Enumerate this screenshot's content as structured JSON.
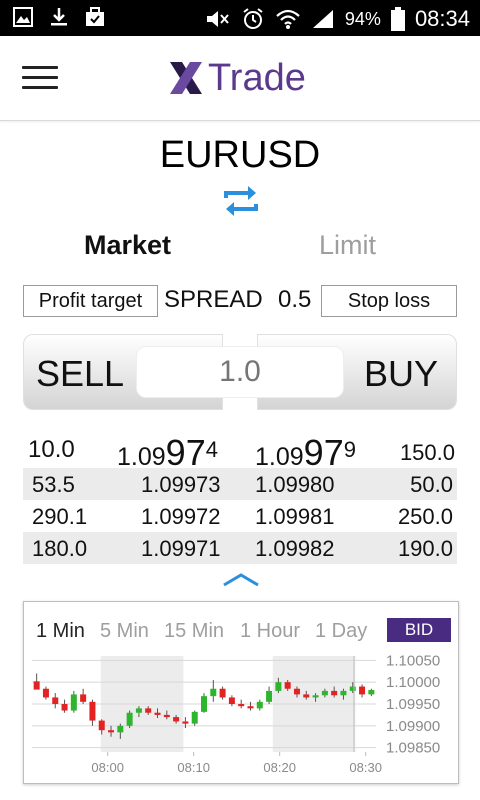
{
  "status_bar": {
    "battery_pct": "94%",
    "time": "08:34",
    "icons": [
      "gallery-icon",
      "download-icon",
      "briefcase-icon",
      "mute-icon",
      "alarm-icon",
      "wifi-icon",
      "signal-icon",
      "battery-icon"
    ]
  },
  "app": {
    "logo_text": "Trade",
    "menu_icon": "hamburger-icon"
  },
  "symbol": "EURUSD",
  "tabs": {
    "market": "Market",
    "limit": "Limit"
  },
  "controls": {
    "profit_target": "Profit target",
    "spread_label": "SPREAD",
    "spread_value": "0.5",
    "stop_loss": "Stop loss"
  },
  "trade": {
    "sell": "SELL",
    "buy": "BUY",
    "quantity_placeholder": "1.0"
  },
  "orderbook": {
    "top": {
      "bid_volume": "10.0",
      "bid_prefix": "1.09",
      "bid_big": "97",
      "bid_pip": "4",
      "ask_prefix": "1.09",
      "ask_big": "97",
      "ask_pip": "9",
      "ask_volume": "150.0"
    },
    "rows": [
      {
        "bid_volume": "53.5",
        "bid": "1.09973",
        "ask": "1.09980",
        "ask_volume": "50.0"
      },
      {
        "bid_volume": "290.1",
        "bid": "1.09972",
        "ask": "1.09981",
        "ask_volume": "250.0"
      },
      {
        "bid_volume": "180.0",
        "bid": "1.09971",
        "ask": "1.09982",
        "ask_volume": "190.0"
      }
    ]
  },
  "chart": {
    "timeframes": [
      "1 Min",
      "5 Min",
      "15 Min",
      "1 Hour",
      "1 Day"
    ],
    "active_timeframe": "1 Min",
    "price_mode": "BID",
    "y_ticks": [
      "1.10050",
      "1.10000",
      "1.09950",
      "1.09900",
      "1.09850"
    ],
    "x_ticks": [
      "08:00",
      "08:10",
      "08:20",
      "08:30"
    ],
    "colors": {
      "up": "#2db52d",
      "down": "#e52222",
      "shade": "#ececec",
      "accent": "#4a2b82"
    }
  },
  "chart_data": {
    "type": "candlestick",
    "y_range": [
      1.0984,
      1.1006
    ],
    "y_ticks": [
      1.1005,
      1.1,
      1.0995,
      1.099,
      1.0985
    ],
    "x_ticks": [
      "08:00",
      "08:10",
      "08:20",
      "08:30"
    ],
    "candles": [
      {
        "o": 1.10002,
        "h": 1.1002,
        "l": 1.09985,
        "c": 1.09983
      },
      {
        "o": 1.09985,
        "h": 1.0999,
        "l": 1.0996,
        "c": 1.09965
      },
      {
        "o": 1.09965,
        "h": 1.09975,
        "l": 1.0994,
        "c": 1.0995
      },
      {
        "o": 1.0995,
        "h": 1.0996,
        "l": 1.0993,
        "c": 1.09935
      },
      {
        "o": 1.09935,
        "h": 1.0998,
        "l": 1.0993,
        "c": 1.09972
      },
      {
        "o": 1.09972,
        "h": 1.09985,
        "l": 1.0995,
        "c": 1.09955
      },
      {
        "o": 1.09955,
        "h": 1.0996,
        "l": 1.099,
        "c": 1.09912
      },
      {
        "o": 1.09912,
        "h": 1.09915,
        "l": 1.0988,
        "c": 1.0989
      },
      {
        "o": 1.0989,
        "h": 1.099,
        "l": 1.09875,
        "c": 1.09885
      },
      {
        "o": 1.09885,
        "h": 1.09905,
        "l": 1.0987,
        "c": 1.099
      },
      {
        "o": 1.099,
        "h": 1.09935,
        "l": 1.09895,
        "c": 1.0993
      },
      {
        "o": 1.0993,
        "h": 1.09945,
        "l": 1.0992,
        "c": 1.0994
      },
      {
        "o": 1.0994,
        "h": 1.09945,
        "l": 1.09925,
        "c": 1.0993
      },
      {
        "o": 1.0993,
        "h": 1.0994,
        "l": 1.09918,
        "c": 1.09925
      },
      {
        "o": 1.09925,
        "h": 1.09935,
        "l": 1.09915,
        "c": 1.0992
      },
      {
        "o": 1.0992,
        "h": 1.09925,
        "l": 1.09905,
        "c": 1.0991
      },
      {
        "o": 1.0991,
        "h": 1.0992,
        "l": 1.09895,
        "c": 1.09905
      },
      {
        "o": 1.09905,
        "h": 1.09935,
        "l": 1.099,
        "c": 1.09932
      },
      {
        "o": 1.09932,
        "h": 1.09975,
        "l": 1.0993,
        "c": 1.09968
      },
      {
        "o": 1.09968,
        "h": 1.10005,
        "l": 1.09955,
        "c": 1.09985
      },
      {
        "o": 1.09985,
        "h": 1.0999,
        "l": 1.0996,
        "c": 1.09965
      },
      {
        "o": 1.09965,
        "h": 1.0997,
        "l": 1.09945,
        "c": 1.0995
      },
      {
        "o": 1.0995,
        "h": 1.0996,
        "l": 1.0994,
        "c": 1.09945
      },
      {
        "o": 1.09945,
        "h": 1.09955,
        "l": 1.09935,
        "c": 1.0994
      },
      {
        "o": 1.0994,
        "h": 1.0996,
        "l": 1.09935,
        "c": 1.09955
      },
      {
        "o": 1.09955,
        "h": 1.0999,
        "l": 1.0995,
        "c": 1.0998
      },
      {
        "o": 1.0998,
        "h": 1.1001,
        "l": 1.09975,
        "c": 1.1
      },
      {
        "o": 1.1,
        "h": 1.10005,
        "l": 1.0998,
        "c": 1.09985
      },
      {
        "o": 1.09985,
        "h": 1.0999,
        "l": 1.09965,
        "c": 1.09972
      },
      {
        "o": 1.09972,
        "h": 1.0998,
        "l": 1.0996,
        "c": 1.09965
      },
      {
        "o": 1.09965,
        "h": 1.09975,
        "l": 1.09955,
        "c": 1.0997
      },
      {
        "o": 1.0997,
        "h": 1.09985,
        "l": 1.09965,
        "c": 1.0998
      },
      {
        "o": 1.0998,
        "h": 1.0999,
        "l": 1.09965,
        "c": 1.0997
      },
      {
        "o": 1.0997,
        "h": 1.09985,
        "l": 1.0996,
        "c": 1.0998
      },
      {
        "o": 1.0998,
        "h": 1.1,
        "l": 1.09975,
        "c": 1.0999
      },
      {
        "o": 1.0999,
        "h": 1.09995,
        "l": 1.09965,
        "c": 1.09972
      },
      {
        "o": 1.09972,
        "h": 1.09985,
        "l": 1.09968,
        "c": 1.09982
      }
    ]
  }
}
